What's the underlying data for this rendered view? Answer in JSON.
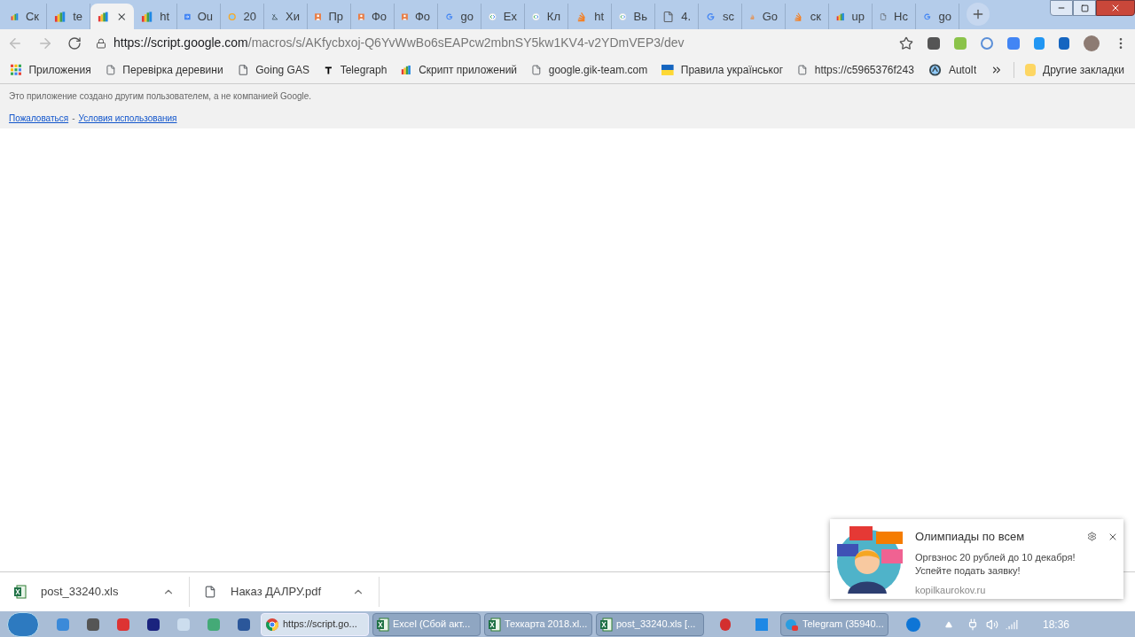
{
  "tabs": [
    {
      "kind": "script",
      "label": "Ск",
      "selected": false
    },
    {
      "kind": "script",
      "label": "te",
      "selected": false
    },
    {
      "kind": "script",
      "selected": true
    },
    {
      "kind": "script",
      "label": "ht",
      "selected": false
    },
    {
      "kind": "arrow",
      "label": "Ou",
      "selected": false
    },
    {
      "kind": "circle",
      "label": "20",
      "selected": false
    },
    {
      "kind": "chart",
      "label": "Хи",
      "selected": false
    },
    {
      "kind": "person",
      "label": "Пр",
      "selected": false
    },
    {
      "kind": "person",
      "label": "Фо",
      "selected": false
    },
    {
      "kind": "person",
      "label": "Фо",
      "selected": false
    },
    {
      "kind": "google",
      "label": "go",
      "selected": false
    },
    {
      "kind": "code",
      "label": "Ex",
      "selected": false
    },
    {
      "kind": "code",
      "label": "Кл",
      "selected": false
    },
    {
      "kind": "stack",
      "label": "ht",
      "selected": false
    },
    {
      "kind": "code",
      "label": "Вь",
      "selected": false
    },
    {
      "kind": "doc",
      "label": "4.",
      "selected": false
    },
    {
      "kind": "google",
      "label": "sc",
      "selected": false
    },
    {
      "kind": "stack",
      "label": "Go",
      "selected": false
    },
    {
      "kind": "stack",
      "label": "ск",
      "selected": false
    },
    {
      "kind": "script",
      "label": "up",
      "selected": false
    },
    {
      "kind": "doc",
      "label": "Hc",
      "selected": false
    },
    {
      "kind": "google",
      "label": "go",
      "selected": false
    }
  ],
  "address": {
    "host": "https://script.google.com",
    "path": "/macros/s/AKfycbxoj-Q6YvWwBo6sEAPcw2mbnSY5kw1KV4-v2YDmVEP3/dev"
  },
  "bookmarks": [
    {
      "kind": "apps",
      "label": "Приложения"
    },
    {
      "kind": "doc",
      "label": "Перевірка деревини"
    },
    {
      "kind": "doc",
      "label": "Going GAS"
    },
    {
      "kind": "telegraph",
      "label": "Telegraph"
    },
    {
      "kind": "script",
      "label": "Скрипт приложений"
    },
    {
      "kind": "doc",
      "label": "google.gik-team.com"
    },
    {
      "kind": "flag",
      "label": "Правила українськог"
    },
    {
      "kind": "doc",
      "label": "https://c5965376f243"
    },
    {
      "kind": "autoit",
      "label": "AutoIt"
    }
  ],
  "other_bookmarks": "Другие закладки",
  "info_bar": {
    "notice": "Это приложение создано другим пользователем, а не компанией Google.",
    "report_link": "Пожаловаться",
    "separator": "-",
    "terms_link": "Условия использования"
  },
  "notification": {
    "title": "Олимпиады по всем",
    "body": "Оргвзнос 20 рублей до 10 декабря! Успейте подать заявку!",
    "source": "kopilkaurokov.ru"
  },
  "downloads": [
    {
      "kind": "excel",
      "name": "post_33240.xls"
    },
    {
      "kind": "doc",
      "name": "Наказ ДАЛРУ.pdf"
    }
  ],
  "taskbar": {
    "windows": [
      {
        "kind": "chrome",
        "label": "https://script.go...",
        "selected": true
      },
      {
        "kind": "excel",
        "label": "Excel (Сбой акт...",
        "selected": false
      },
      {
        "kind": "excel",
        "label": "Техкарта 2018.xl...",
        "selected": false
      },
      {
        "kind": "excel",
        "label": "post_33240.xls  [...",
        "selected": false
      },
      {
        "kind": "telegram",
        "label": "Telegram (35940...",
        "selected": false
      }
    ],
    "clock": "18:36"
  }
}
